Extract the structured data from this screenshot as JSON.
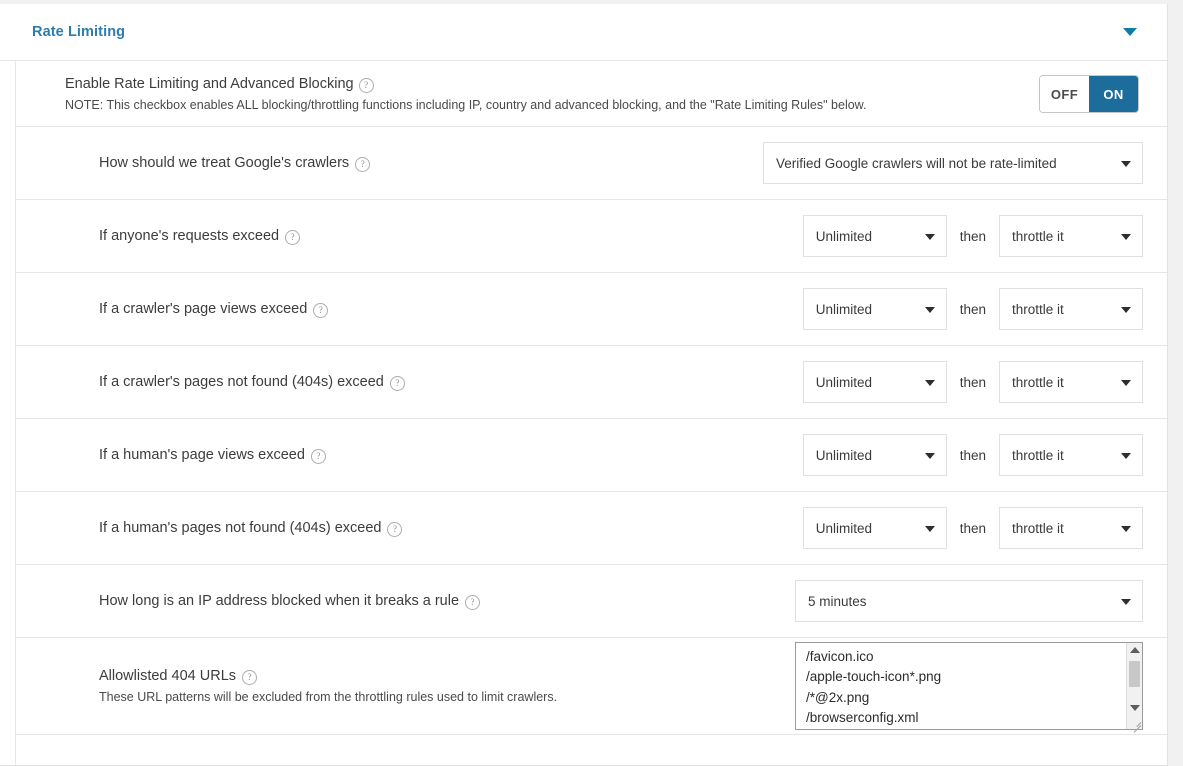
{
  "panel": {
    "title": "Rate Limiting",
    "collapse_icon": "chevron-down-icon"
  },
  "enable": {
    "label": "Enable Rate Limiting and Advanced Blocking",
    "help_glyph": "?",
    "note": "NOTE: This checkbox enables ALL blocking/throttling functions including IP, country and advanced blocking, and the \"Rate Limiting Rules\" below.",
    "toggle": {
      "off_label": "OFF",
      "on_label": "ON",
      "state": "ON",
      "active_color": "#1c6c9c"
    }
  },
  "rows": [
    {
      "label": "How should we treat Google's crawlers",
      "select_value": "Verified Google crawlers will not be rate-limited"
    },
    {
      "label": "If anyone's requests exceed",
      "limit_value": "Unlimited",
      "then_label": "then",
      "action_value": "throttle it"
    },
    {
      "label": "If a crawler's page views exceed",
      "limit_value": "Unlimited",
      "then_label": "then",
      "action_value": "throttle it"
    },
    {
      "label": "If a crawler's pages not found (404s) exceed",
      "limit_value": "Unlimited",
      "then_label": "then",
      "action_value": "throttle it"
    },
    {
      "label": "If a human's page views exceed",
      "limit_value": "Unlimited",
      "then_label": "then",
      "action_value": "throttle it"
    },
    {
      "label": "If a human's pages not found (404s) exceed",
      "limit_value": "Unlimited",
      "then_label": "then",
      "action_value": "throttle it"
    },
    {
      "label": "How long is an IP address blocked when it breaks a rule",
      "select_value": "5 minutes"
    }
  ],
  "allowlist": {
    "label": "Allowlisted 404 URLs",
    "sub_label": "These URL patterns will be excluded from the throttling rules used to limit crawlers.",
    "value": "/favicon.ico\n/apple-touch-icon*.png\n/*@2x.png\n/browserconfig.xml"
  },
  "colors": {
    "title_blue": "#2c7cb0",
    "accent_blue": "#1c6c9c",
    "page_bg": "#f1f1f1",
    "border": "#e6e6e6"
  }
}
